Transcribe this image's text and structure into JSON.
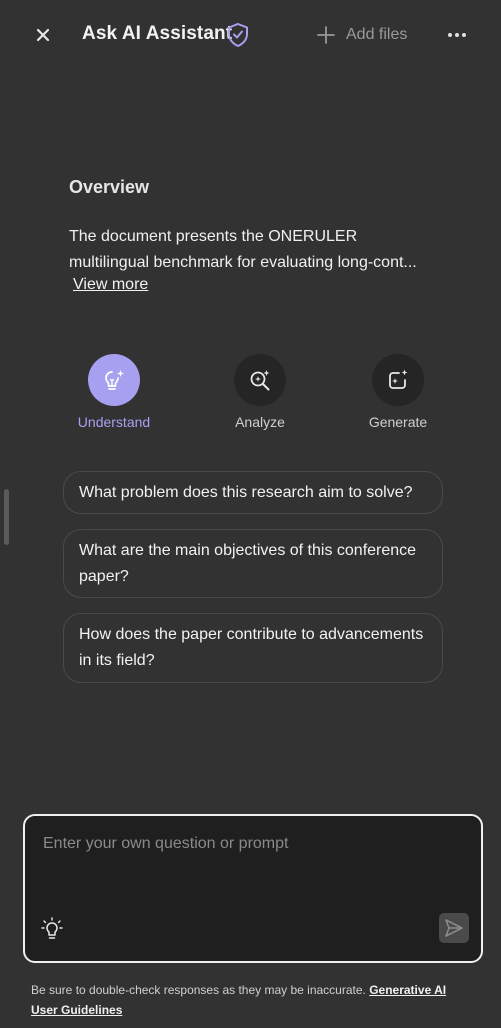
{
  "header": {
    "title": "Ask AI Assistant",
    "add_files_label": "Add files",
    "close_icon": "close-icon",
    "shield_icon": "shield-check-icon",
    "more_icon": "more-horizontal-icon"
  },
  "overview": {
    "title": "Overview",
    "text": "The document presents the ONERULER multilingual benchmark for evaluating long-cont...",
    "view_more_label": "View more"
  },
  "actions": [
    {
      "label": "Understand",
      "icon": "lightbulb-sparkle-icon",
      "active": true
    },
    {
      "label": "Analyze",
      "icon": "magnifier-sparkle-icon",
      "active": false
    },
    {
      "label": "Generate",
      "icon": "frame-sparkle-icon",
      "active": false
    }
  ],
  "suggestions": [
    "What problem does this research aim to solve?",
    "What are the main objectives of this conference paper?",
    "How does the paper contribute to advancements in its field?"
  ],
  "prompt": {
    "placeholder": "Enter your own question or prompt",
    "value": "",
    "bulb_icon": "lightbulb-icon",
    "send_icon": "send-icon"
  },
  "disclaimer": {
    "text": "Be sure to double-check responses as they may be inaccurate.",
    "link_label": "Generative AI User Guidelines"
  },
  "colors": {
    "background": "#323232",
    "accent": "#a7a0f0",
    "input_background": "#1f1f1f"
  }
}
